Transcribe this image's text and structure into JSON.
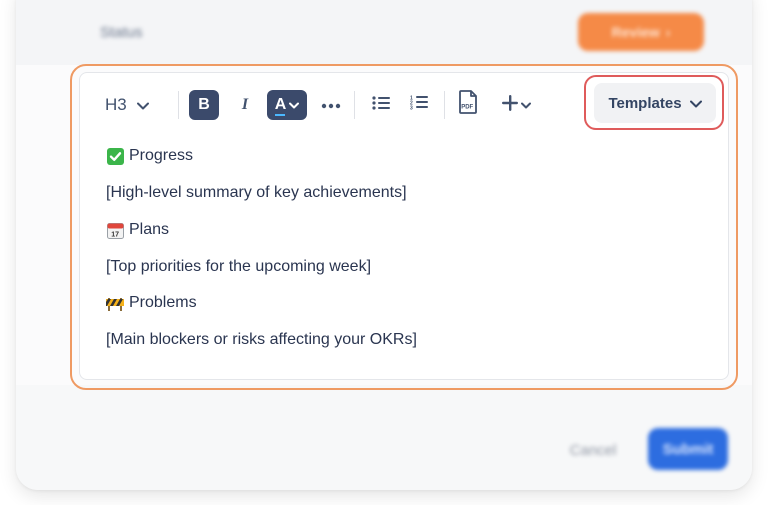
{
  "background_form": {
    "status_label": "Status",
    "review_button": {
      "label": "Review",
      "icon": "chevron-right-icon"
    },
    "cancel_label": "Cancel",
    "submit_label": "Submit"
  },
  "toolbar": {
    "heading_level": "H3",
    "bold": "B",
    "italic": "I",
    "text_color": "A",
    "templates_label": "Templates"
  },
  "content": {
    "lines": [
      {
        "icon": "check-mark-emoji",
        "text": "Progress"
      },
      {
        "text": "[High-level summary of key achievements]"
      },
      {
        "icon": "calendar-emoji",
        "text": "Plans"
      },
      {
        "text": "[Top priorities for the upcoming week]"
      },
      {
        "icon": "construction-emoji",
        "text": "Problems"
      },
      {
        "text": "[Main blockers or risks affecting your OKRs]"
      }
    ]
  },
  "colors": {
    "accent_orange": "#f58a47",
    "highlight_red": "#df5b5b",
    "primary_blue": "#2d6de0",
    "toolbar_active": "#3b4a6b"
  }
}
